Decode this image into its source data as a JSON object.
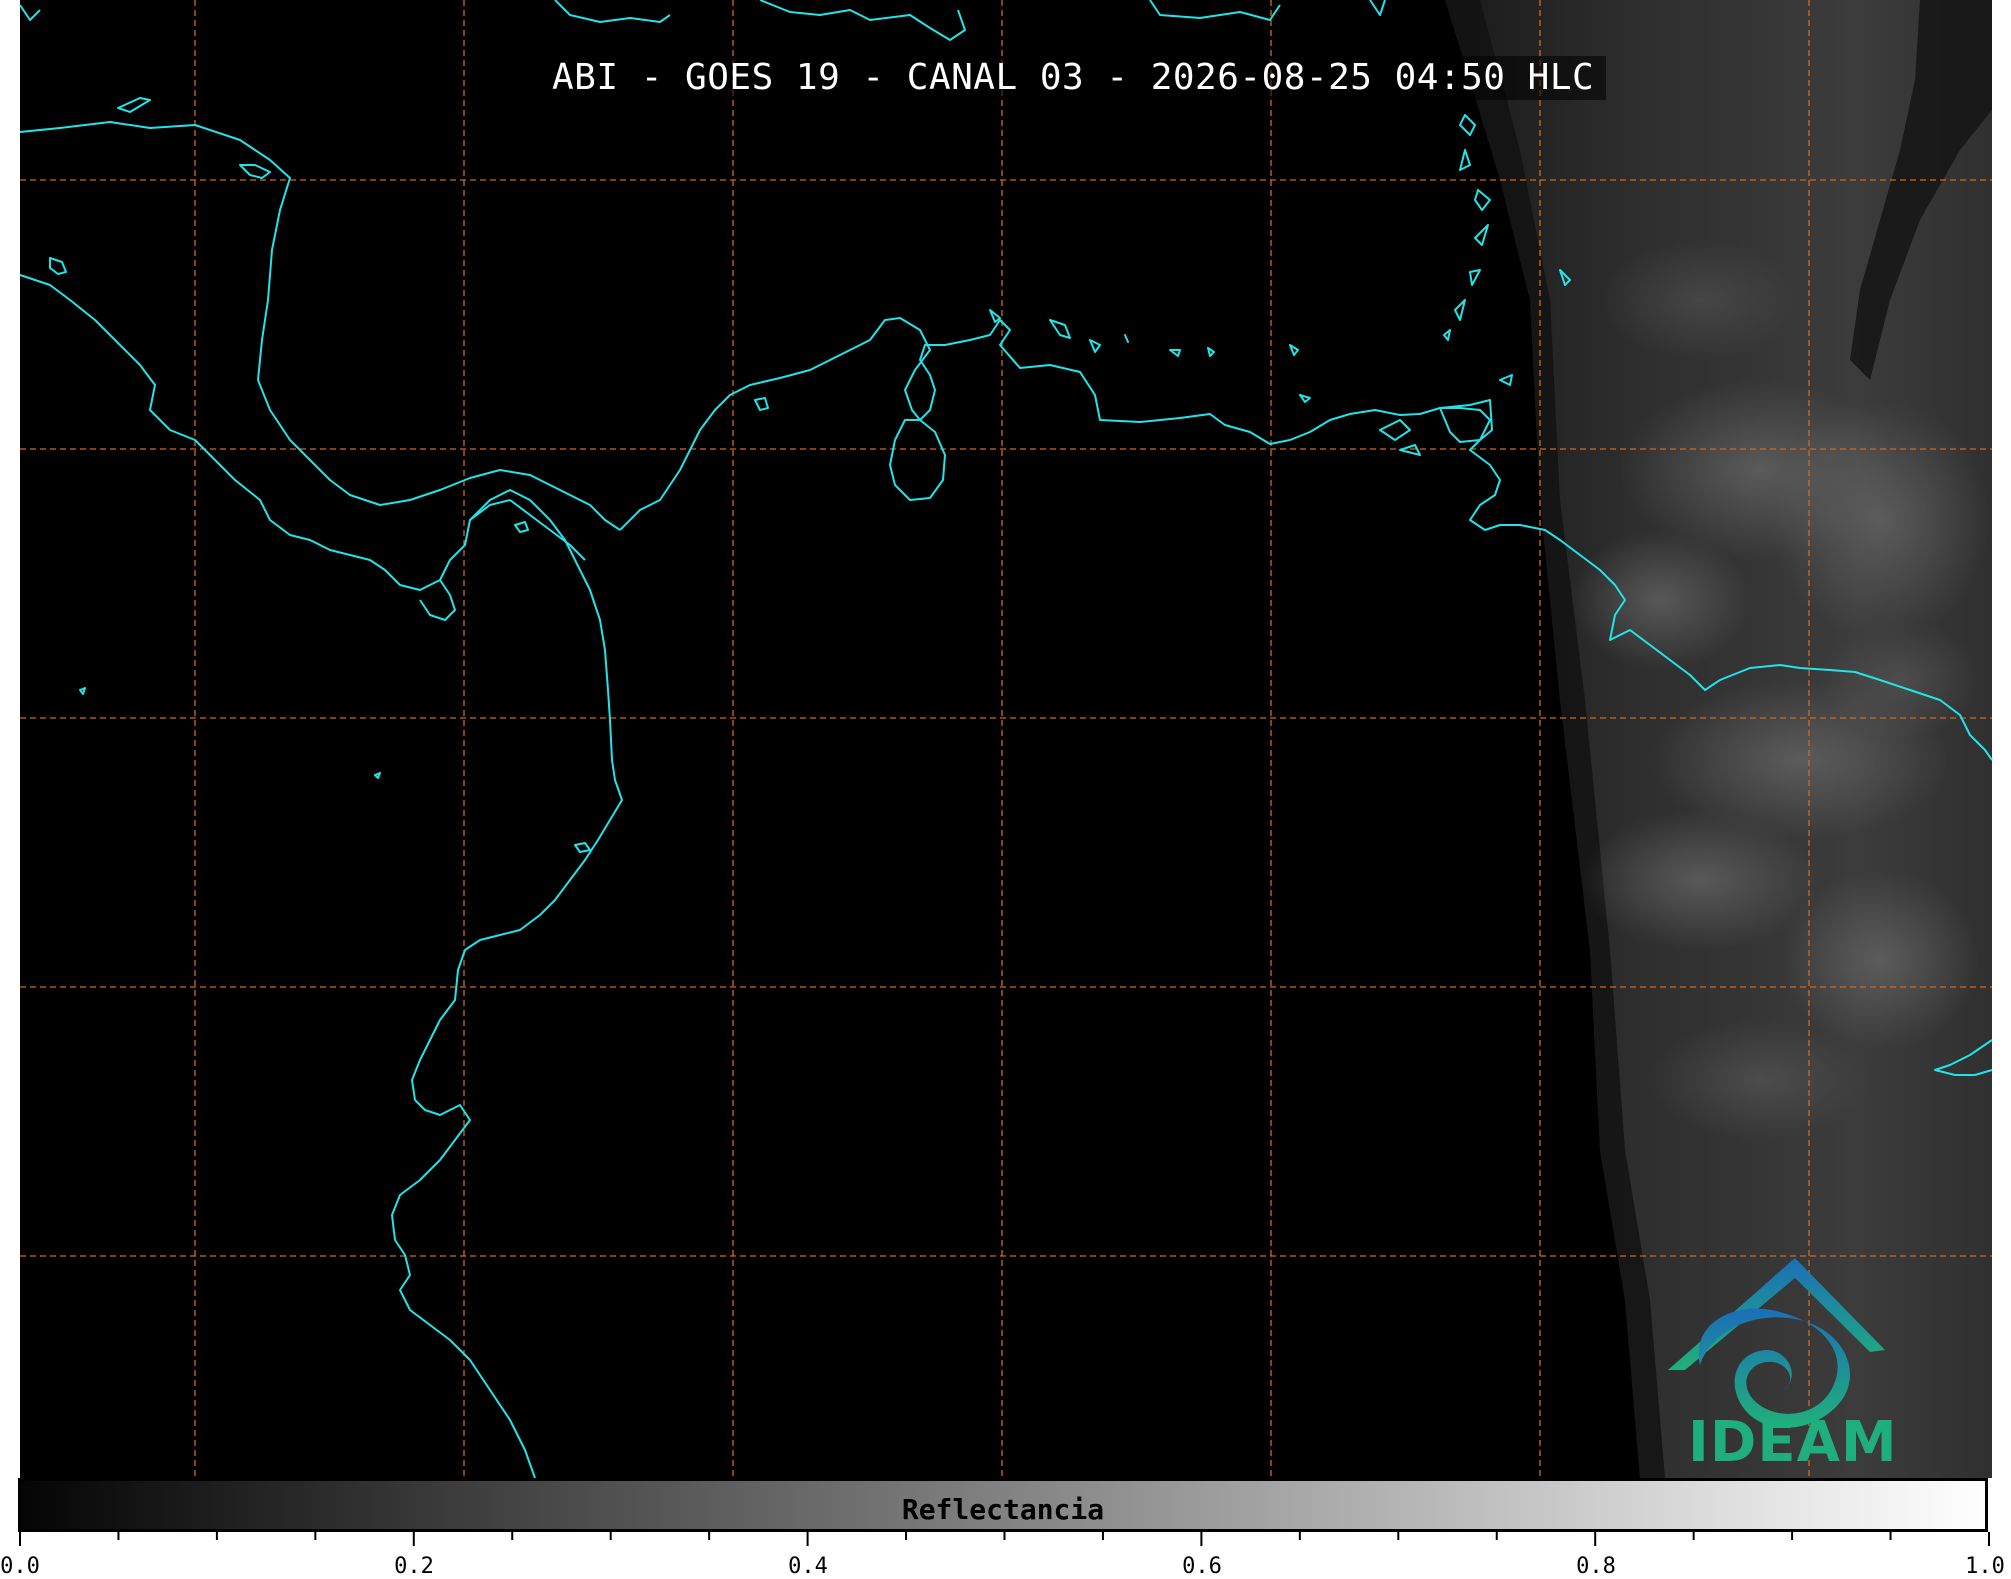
{
  "title": "ABI - GOES 19 - CANAL 03 - 2026-08-25 04:50 HLC",
  "colorbar": {
    "label": "Reflectancia",
    "tick_labels": [
      "0.0",
      "0.2",
      "0.4",
      "0.6",
      "0.8",
      "1.0"
    ],
    "range": [
      0.0,
      1.0
    ],
    "colormap": "grayscale"
  },
  "logo": {
    "text": "IDEAM"
  },
  "colors": {
    "coastline": "#22e4e8",
    "grid": "#d2691e",
    "background": "#000000",
    "logo_primary": "#1fae7e",
    "logo_secondary": "#1c7fb8"
  }
}
